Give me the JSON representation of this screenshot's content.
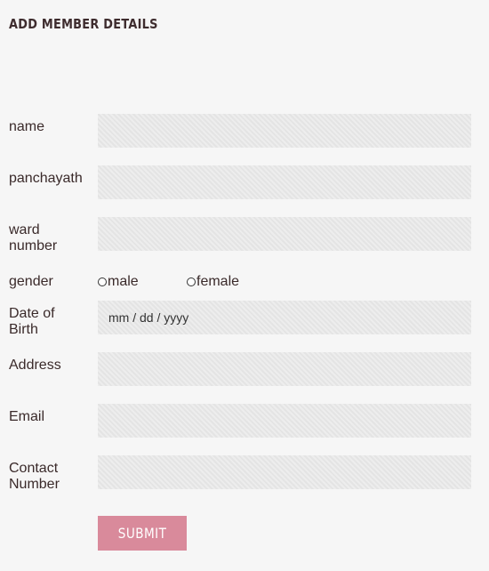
{
  "page": {
    "title": "ADD MEMBER DETAILS"
  },
  "form": {
    "fields": {
      "name": {
        "label": "name",
        "value": ""
      },
      "panchayath": {
        "label": "panchayath",
        "value": ""
      },
      "ward_number": {
        "label_line1": "ward",
        "label_line2": "number",
        "value": ""
      },
      "gender": {
        "label": "gender",
        "options": [
          "male",
          "female"
        ],
        "selected": ""
      },
      "dob": {
        "label_line1": "Date of",
        "label_line2": "Birth",
        "placeholder": "mm / dd / yyyy"
      },
      "address": {
        "label": "Address",
        "value": ""
      },
      "email": {
        "label": "Email",
        "value": ""
      },
      "contact": {
        "label_line1": "Contact",
        "label_line2": "Number",
        "value": ""
      }
    },
    "submit_label": "SUBMIT"
  },
  "colors": {
    "background": "#f6f6f6",
    "field_background": "#e9e9e9",
    "submit_button": "#d98a9b",
    "text": "#3a2a2a"
  }
}
